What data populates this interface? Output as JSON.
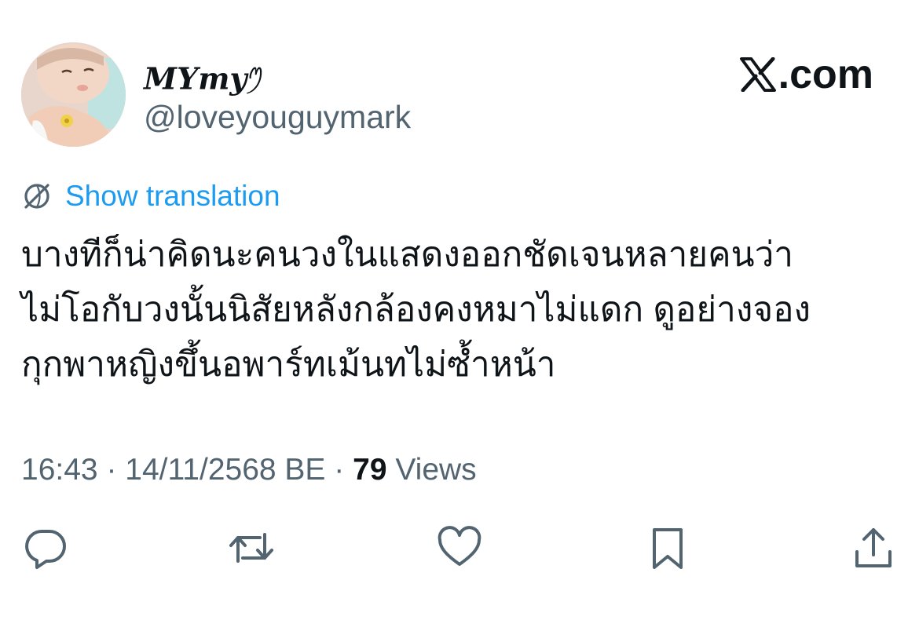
{
  "author": {
    "display_name": "MYmy",
    "display_name_decoration": "ꪑ",
    "handle": "@loveyouguymark",
    "avatar_icon": "profile-photo"
  },
  "brand": {
    "logo_icon": "x-logo-icon",
    "domain_suffix": ".com"
  },
  "translate": {
    "icon": "globe-icon",
    "label": "Show translation"
  },
  "tweet": {
    "lines": [
      "บางทีก็น่าคิดนะคนวงในแสดงออกชัดเจนหลายคนว่า",
      "ไม่โอกับวงนั้นนิสัยหลังกล้องคงหมาไม่แดก ดูอย่างจอง",
      "กุกพาหญิงขึ้นอพาร์ทเม้นทไม่ซ้ำหน้า"
    ]
  },
  "meta": {
    "time": "16:43",
    "separator": " · ",
    "date": "14/11/2568 BE",
    "views_count": "79",
    "views_label": "Views"
  },
  "actions": [
    {
      "name": "reply",
      "icon": "reply-icon"
    },
    {
      "name": "repost",
      "icon": "repost-icon"
    },
    {
      "name": "like",
      "icon": "heart-icon"
    },
    {
      "name": "bookmark",
      "icon": "bookmark-icon"
    },
    {
      "name": "share",
      "icon": "share-icon"
    }
  ],
  "colors": {
    "text_primary": "#0f1419",
    "text_secondary": "#536471",
    "link_blue": "#1d9bf0",
    "icon_gray": "#536471"
  }
}
